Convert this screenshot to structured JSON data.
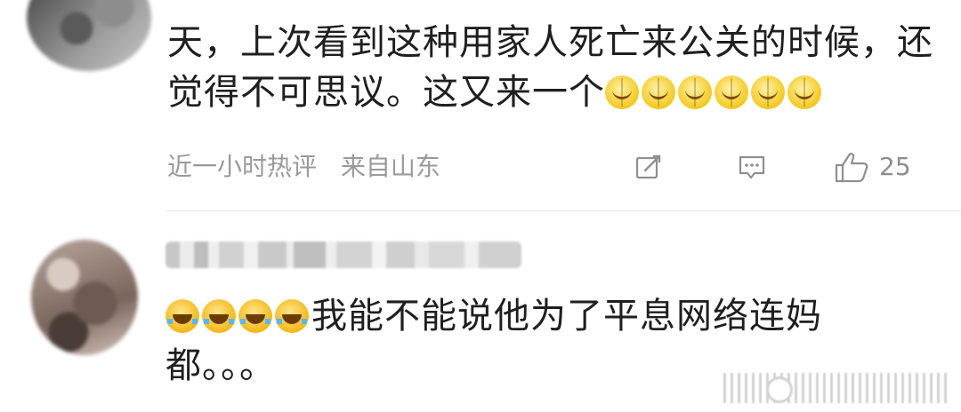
{
  "comments": [
    {
      "text": "天，上次看到这种用家人死亡来公关的时候，还觉得不可思议。这又来一个",
      "emoji_suffix": [
        "smile-emoji",
        "smile-emoji",
        "smile-emoji",
        "smile-emoji",
        "smile-emoji",
        "smile-emoji"
      ],
      "meta": {
        "time": "近一小时热评",
        "location": "来自山东",
        "like_count": "25"
      },
      "icons": {
        "share": "edit-share-icon",
        "reply": "comment-icon",
        "like": "thumbs-up-icon"
      }
    },
    {
      "emoji_prefix": [
        "laughing-tears-emoji",
        "laughing-tears-emoji",
        "laughing-tears-emoji",
        "laughing-tears-emoji"
      ],
      "text": "我能不能说他为了平息网络连妈都。。。"
    }
  ],
  "colors": {
    "text": "#1f1f1f",
    "meta": "#9a9a9a",
    "divider": "#e6e6e6"
  }
}
